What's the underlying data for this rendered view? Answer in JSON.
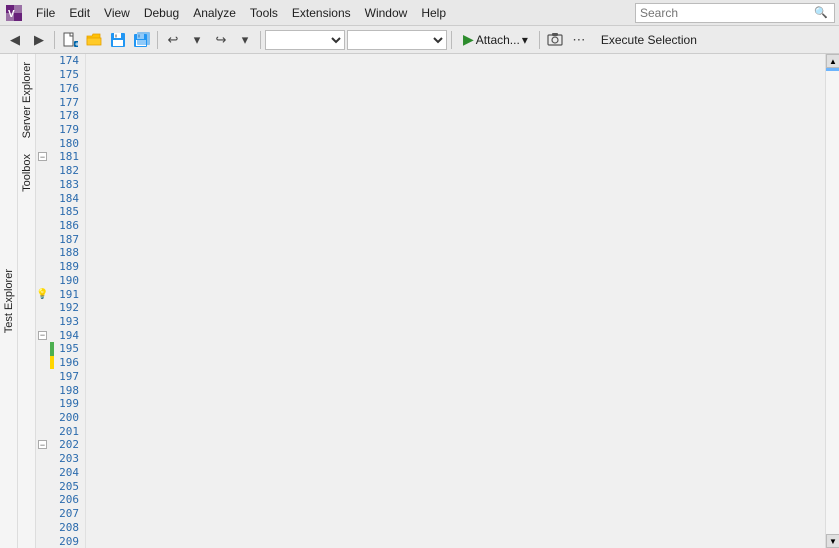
{
  "menubar": {
    "items": [
      "File",
      "Edit",
      "View",
      "Debug",
      "Analyze",
      "Tools",
      "Extensions",
      "Window",
      "Help"
    ],
    "search_placeholder": "Search"
  },
  "toolbar": {
    "back_label": "←",
    "forward_label": "→",
    "undo_label": "↩",
    "redo_label": "↪",
    "attach_label": "Attach...",
    "execute_label": "Execute Selection",
    "dropdown1_value": "",
    "dropdown2_value": ""
  },
  "panels": {
    "test_explorer_label": "Test Explorer",
    "server_explorer_label": "Server Explorer",
    "toolbox_label": "Toolbox"
  },
  "line_numbers": [
    174,
    175,
    176,
    177,
    178,
    179,
    180,
    181,
    182,
    183,
    184,
    185,
    186,
    187,
    188,
    189,
    190,
    191,
    192,
    193,
    194,
    195,
    196,
    197,
    198,
    199,
    200,
    201,
    202,
    203,
    204,
    205,
    206,
    207,
    208,
    209
  ],
  "collapse_rows": [
    181,
    194,
    202
  ],
  "green_indicator_rows": [
    195
  ],
  "yellow_indicator_rows": [
    196
  ],
  "lightbulb_row": 191
}
